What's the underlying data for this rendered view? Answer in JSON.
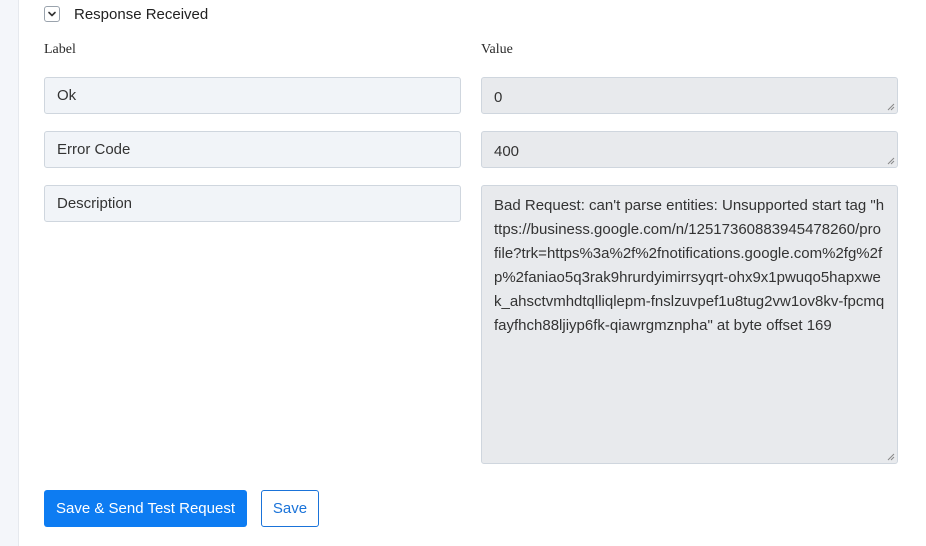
{
  "section": {
    "title": "Response Received",
    "toggle_icon": "chevron-down-icon"
  },
  "columns": {
    "label": "Label",
    "value": "Value"
  },
  "rows": [
    {
      "label": "Ok",
      "value": "0"
    },
    {
      "label": "Error Code",
      "value": "400"
    },
    {
      "label": "Description",
      "value": "Bad Request: can't parse entities: Unsupported start tag \"https://business.google.com/n/12517360883945478260/profile?trk=https%3a%2f%2fnotifications.google.com%2fg%2fp%2faniao5q3rak9hrurdyimirrsyqrt-ohx9x1pwuqo5hapxwek_ahsctvmhdtqlliqlepm-fnslzuvpef1u8tug2vw1ov8kv-fpcmqfayfhch88ljiyp6fk-qiawrgmznpha\" at byte offset 169"
    }
  ],
  "buttons": {
    "save_and_test": "Save & Send Test Request",
    "save": "Save"
  },
  "colors": {
    "primary": "#0d7cf2",
    "label_field_bg": "#f1f4f8",
    "value_field_bg": "#e8eaed"
  }
}
